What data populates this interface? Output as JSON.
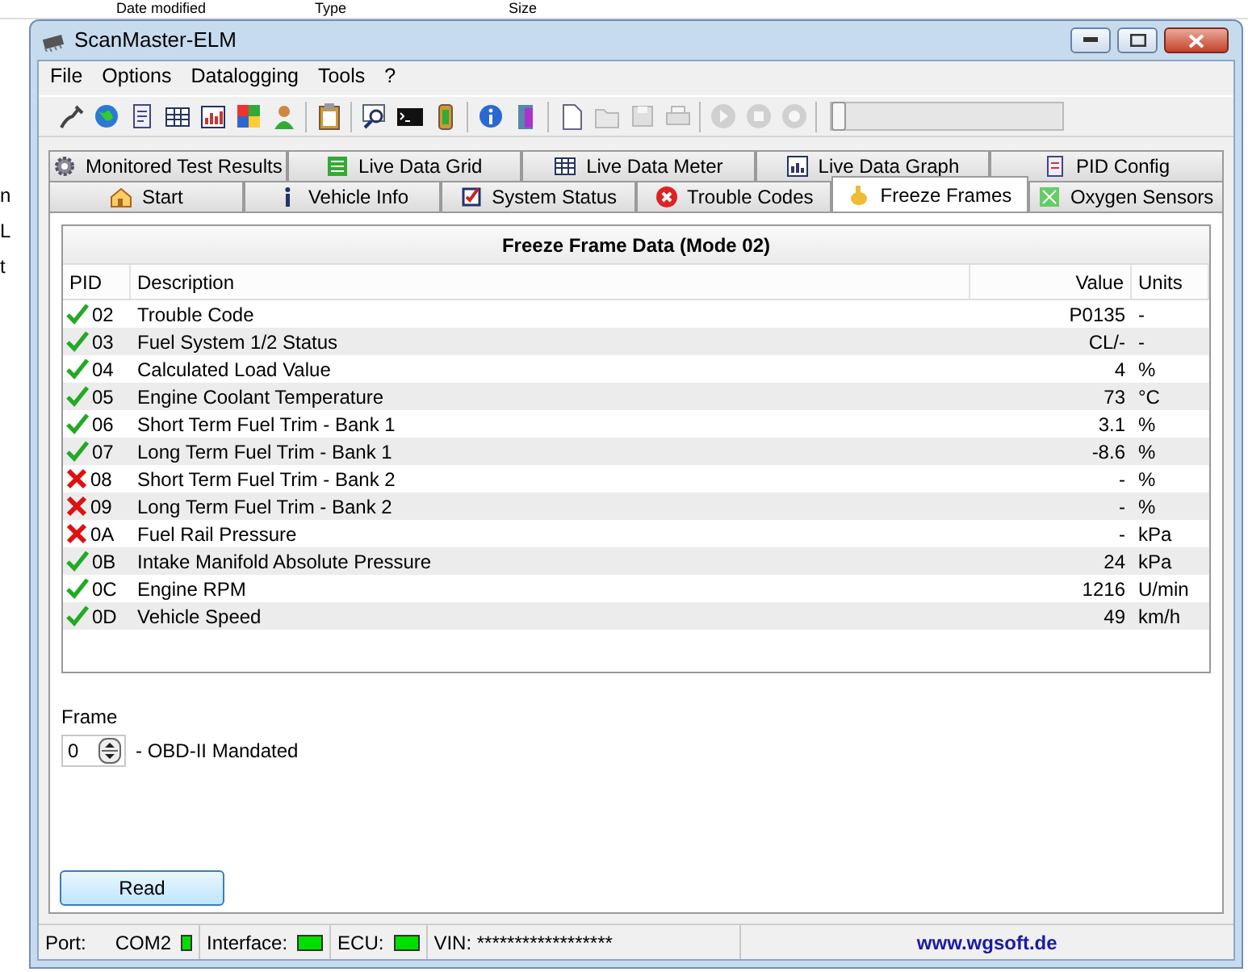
{
  "background": {
    "columns": [
      "Date modified",
      "Type",
      "Size"
    ],
    "fragments": [
      "n",
      "L",
      "t"
    ]
  },
  "window": {
    "title": "ScanMaster-ELM"
  },
  "menu": [
    "File",
    "Options",
    "Datalogging",
    "Tools",
    "?"
  ],
  "toolbar": {
    "groups": [
      {
        "buttons": [
          {
            "disabled": false
          },
          {
            "disabled": false
          },
          {
            "disabled": false
          },
          {
            "disabled": false
          },
          {
            "disabled": false
          },
          {
            "disabled": false
          },
          {
            "disabled": false
          }
        ]
      },
      {
        "buttons": [
          {
            "disabled": false
          }
        ]
      },
      {
        "buttons": [
          {
            "disabled": false
          },
          {
            "disabled": false
          },
          {
            "disabled": false
          }
        ]
      },
      {
        "buttons": [
          {
            "disabled": false
          },
          {
            "disabled": false
          }
        ]
      },
      {
        "buttons": [
          {
            "disabled": false
          },
          {
            "disabled": true
          },
          {
            "disabled": true
          },
          {
            "disabled": true
          }
        ]
      },
      {
        "buttons": [
          {
            "disabled": true
          },
          {
            "disabled": true
          },
          {
            "disabled": true
          }
        ]
      }
    ],
    "slider": {
      "level": 0
    }
  },
  "tab_rows": [
    {
      "tabs": [
        {
          "label": "Monitored Test Results",
          "selected": false
        },
        {
          "label": "Live Data Grid",
          "selected": false
        },
        {
          "label": "Live Data Meter",
          "selected": false
        },
        {
          "label": "Live Data Graph",
          "selected": false
        },
        {
          "label": "PID Config",
          "selected": false
        }
      ]
    },
    {
      "tabs": [
        {
          "label": "Start",
          "selected": false
        },
        {
          "label": "Vehicle Info",
          "selected": false
        },
        {
          "label": "System Status",
          "selected": false
        },
        {
          "label": "Trouble Codes",
          "selected": false
        },
        {
          "label": "Freeze Frames",
          "selected": true
        },
        {
          "label": "Oxygen Sensors",
          "selected": false
        }
      ]
    }
  ],
  "table": {
    "title": "Freeze Frame Data (Mode 02)",
    "columns": [
      "PID",
      "Description",
      "Value",
      "Units"
    ],
    "rows": [
      {
        "supported": true,
        "pid": "02",
        "description": "Trouble Code",
        "value": "P0135",
        "units": "-"
      },
      {
        "supported": true,
        "pid": "03",
        "description": "Fuel System 1/2 Status",
        "value": "CL/-",
        "units": "-"
      },
      {
        "supported": true,
        "pid": "04",
        "description": "Calculated Load Value",
        "value": "4",
        "units": "%"
      },
      {
        "supported": true,
        "pid": "05",
        "description": "Engine Coolant Temperature",
        "value": "73",
        "units": "°C"
      },
      {
        "supported": true,
        "pid": "06",
        "description": "Short Term Fuel Trim - Bank 1",
        "value": "3.1",
        "units": "%"
      },
      {
        "supported": true,
        "pid": "07",
        "description": "Long Term Fuel Trim - Bank 1",
        "value": "-8.6",
        "units": "%"
      },
      {
        "supported": false,
        "pid": "08",
        "description": "Short Term Fuel Trim - Bank 2",
        "value": "-",
        "units": "%"
      },
      {
        "supported": false,
        "pid": "09",
        "description": "Long Term Fuel Trim - Bank 2",
        "value": "-",
        "units": "%"
      },
      {
        "supported": false,
        "pid": "0A",
        "description": "Fuel Rail Pressure",
        "value": "-",
        "units": "kPa"
      },
      {
        "supported": true,
        "pid": "0B",
        "description": "Intake Manifold Absolute Pressure",
        "value": "24",
        "units": "kPa"
      },
      {
        "supported": true,
        "pid": "0C",
        "description": "Engine RPM",
        "value": "1216",
        "units": "U/min"
      },
      {
        "supported": true,
        "pid": "0D",
        "description": "Vehicle Speed",
        "value": "49",
        "units": "km/h"
      }
    ]
  },
  "frame": {
    "label": "Frame",
    "value": "0",
    "description": "- OBD-II Mandated"
  },
  "read_button": "Read",
  "status_bar": {
    "port_label": "Port:",
    "port": "COM2",
    "port_led": true,
    "interface_label": "Interface:",
    "interface_led": true,
    "ecu_label": "ECU:",
    "ecu_led": true,
    "vin": "VIN: ******************",
    "website": "www.wgsoft.de"
  }
}
